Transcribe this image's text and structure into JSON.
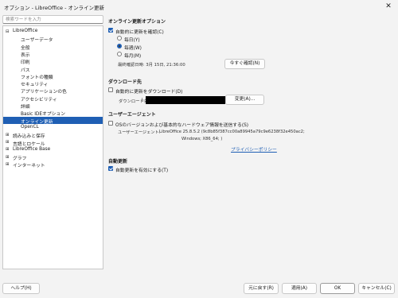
{
  "window": {
    "title": "オプション - LibreOffice - オンライン更新",
    "close_icon": "close-icon"
  },
  "search": {
    "placeholder": "検索ワードを入力"
  },
  "tree": {
    "items": [
      {
        "label": "LibreOffice",
        "expander": "⊟",
        "level": 0
      },
      {
        "label": "ユーザーデータ",
        "level": 1
      },
      {
        "label": "全般",
        "level": 1
      },
      {
        "label": "表示",
        "level": 1
      },
      {
        "label": "印刷",
        "level": 1
      },
      {
        "label": "パス",
        "level": 1
      },
      {
        "label": "フォントの種類",
        "level": 1
      },
      {
        "label": "セキュリティ",
        "level": 1
      },
      {
        "label": "アプリケーションの色",
        "level": 1
      },
      {
        "label": "アクセシビリティ",
        "level": 1
      },
      {
        "label": "詳細",
        "level": 1
      },
      {
        "label": "Basic IDEオプション",
        "level": 1
      },
      {
        "label": "オンライン更新",
        "level": 1,
        "selected": true
      },
      {
        "label": "OpenCL",
        "level": 1
      },
      {
        "label": "読み込みと保存",
        "expander": "⊞",
        "level": 0
      },
      {
        "label": "言語とロケール",
        "expander": "⊞",
        "level": 0
      },
      {
        "label": "LibreOffice Base",
        "expander": "⊞",
        "level": 0
      },
      {
        "label": "グラフ",
        "expander": "⊞",
        "level": 0
      },
      {
        "label": "インターネット",
        "expander": "⊞",
        "level": 0
      }
    ]
  },
  "update_options": {
    "heading": "オンライン更新オプション",
    "auto_check_label": "自動的に更新を確認(C)",
    "auto_check_checked": true,
    "freq": [
      {
        "label": "毎日(Y)",
        "checked": false
      },
      {
        "label": "毎週(W)",
        "checked": true
      },
      {
        "label": "毎月(M)",
        "checked": false
      }
    ],
    "last_checked": "最終確認日時: 3月 15日, 21:36:00",
    "check_now_button": "今すぐ確認(N)"
  },
  "download": {
    "heading": "ダウンロード先",
    "auto_download_label": "自動的に更新をダウンロード(D)",
    "auto_download_checked": false,
    "dest_label": "ダウンロード先:",
    "dest_value": "\\",
    "change_button": "変更(A)..."
  },
  "user_agent": {
    "heading": "ユーザーエージェント",
    "send_os_label": "OSのバージョンおよび基本的なハードウェア情報を送信する(S)",
    "send_os_checked": false,
    "ua_label": "ユーザーエージェント:",
    "ua_value_line1": "LibreOffice 25.8.5.2 (9c8b85f387cc00a89945a79c9e6238f32e450ac2;",
    "ua_value_line2": "Windows; X86_64; )",
    "privacy_link": "プライバシーポリシー"
  },
  "auto_update": {
    "heading": "自動更新",
    "enable_label": "自動更新を有効にする(T)",
    "enable_checked": true
  },
  "footer": {
    "help_button": "ヘルプ(H)",
    "reset_button": "元に戻す(R)",
    "apply_button": "適用(A)",
    "ok_button": "OK",
    "cancel_button": "キャンセル(C)"
  },
  "colors": {
    "accent": "#1f5fb4",
    "background": "#f3f3f3"
  }
}
